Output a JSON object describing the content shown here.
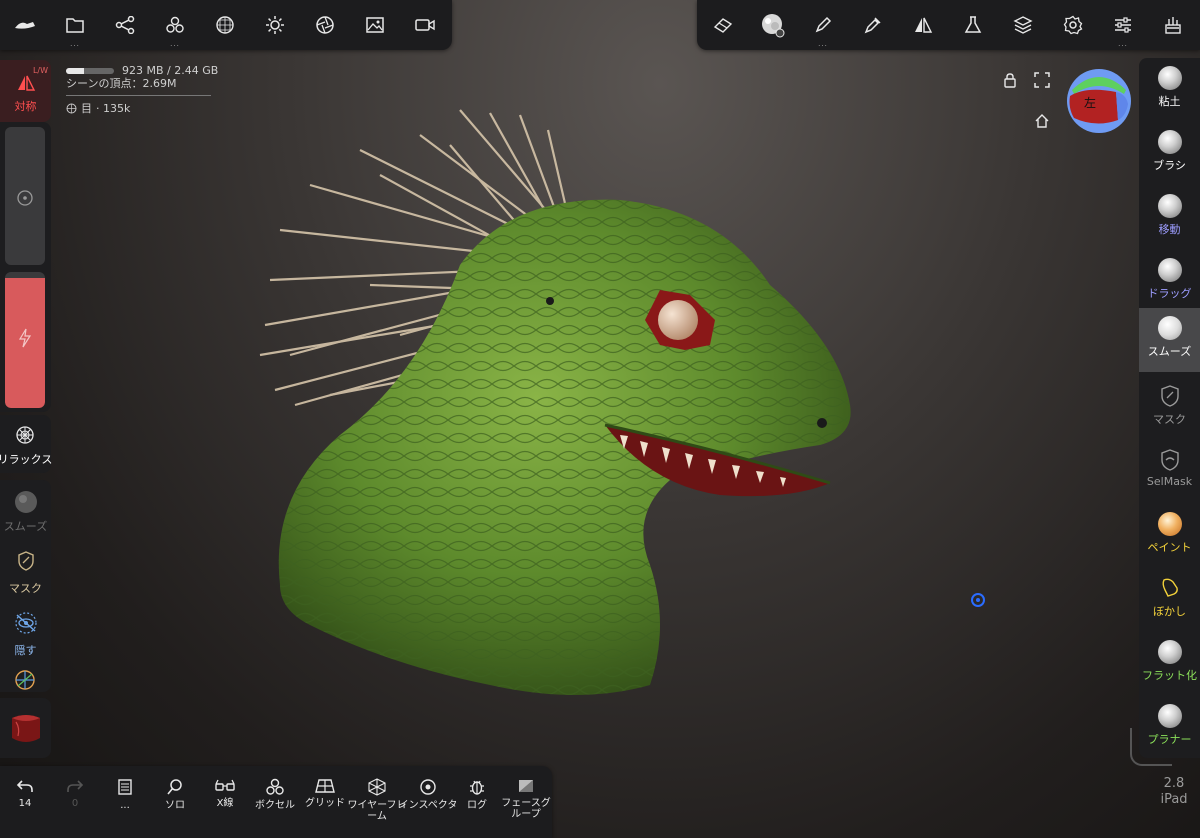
{
  "stats": {
    "memory": "923 MB / 2.44 GB",
    "memory_fraction": 0.38,
    "scene_vertices": "シーンの頂点：2.69M",
    "object_name": "目",
    "object_vertices": "· 135k"
  },
  "left_panel": {
    "symmetry_badge": "L/W",
    "symmetry_label": "対称",
    "relax_label": "リラックス",
    "smooth_label": "スムーズ",
    "mask_label": "マスク",
    "hide_label": "隠す"
  },
  "gizmo": {
    "view_label": "左"
  },
  "right_panel": {
    "tools": [
      {
        "label": "粘土",
        "color": "#ffffff"
      },
      {
        "label": "ブラシ",
        "color": "#ffffff"
      },
      {
        "label": "移動",
        "color": "#9d9dff"
      },
      {
        "label": "ドラッグ",
        "color": "#9d9dff"
      },
      {
        "label": "スムーズ",
        "color": "#ffffff"
      },
      {
        "label": "マスク",
        "color": "#9a9a9a"
      },
      {
        "label": "SelMask",
        "color": "#9a9a9a"
      },
      {
        "label": "ペイント",
        "color": "#f2d13a"
      },
      {
        "label": "ぼかし",
        "color": "#f2d13a"
      },
      {
        "label": "フラット化",
        "color": "#8be05a"
      },
      {
        "label": "プラナー",
        "color": "#8be05a"
      }
    ]
  },
  "bottom_bar": {
    "undo_count": "14",
    "redo_count": "0",
    "scene_label": "...",
    "solo_label": "ソロ",
    "xray_label": "X線",
    "voxel_label": "ボクセル",
    "grid_label": "グリッド",
    "wireframe_label": "ワイヤーフレーム",
    "inspector_label": "インスペクタ",
    "log_label": "ログ",
    "facegroup_label": "フェースグループ"
  },
  "version": {
    "number": "2.8",
    "device": "iPad"
  },
  "colors": {
    "accent_red": "#e25252",
    "sym_red": "#ff4f4f",
    "pointer_blue": "#2a6cff"
  }
}
